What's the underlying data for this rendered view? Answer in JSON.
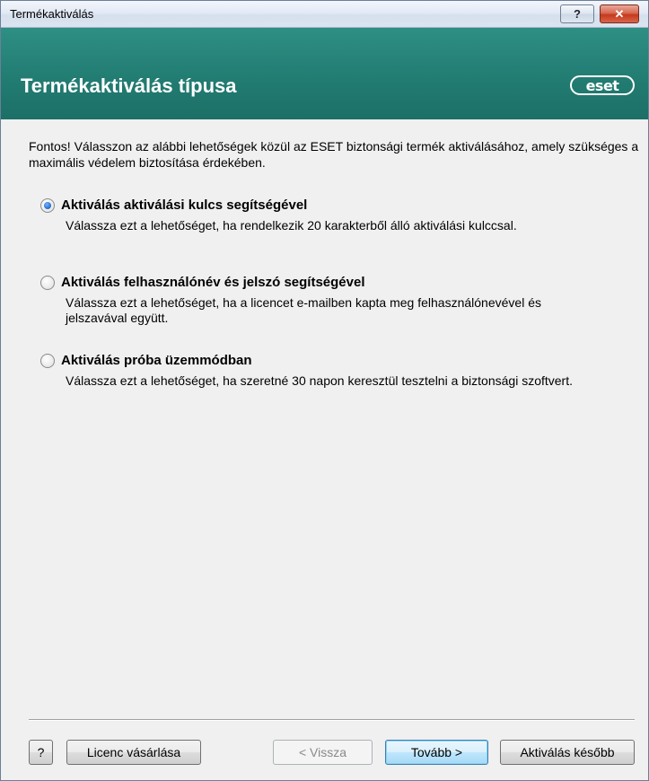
{
  "window": {
    "title": "Termékaktiválás",
    "help_glyph": "?",
    "close_glyph": "✕"
  },
  "header": {
    "heading": "Termékaktiválás típusa",
    "logo_text": "eset"
  },
  "intro": "Fontos! Válasszon az alábbi lehetőségek közül az ESET biztonsági termék aktiválásához, amely szükséges a maximális védelem biztosítása érdekében.",
  "options": [
    {
      "label": "Aktiválás aktiválási kulcs segítségével",
      "description": "Válassza ezt a lehetőséget, ha rendelkezik 20 karakterből álló aktiválási kulccsal.",
      "selected": true
    },
    {
      "label": "Aktiválás felhasználónév és jelszó segítségével",
      "description": "Válassza ezt a lehetőséget, ha a licencet e-mailben kapta meg felhasználónevével és jelszavával együtt.",
      "selected": false
    },
    {
      "label": "Aktiválás próba üzemmódban",
      "description": "Válassza ezt a lehetőséget, ha szeretné 30 napon keresztül tesztelni a biztonsági szoftvert.",
      "selected": false
    }
  ],
  "buttons": {
    "help": "?",
    "buy_license": "Licenc vásárlása",
    "back": "< Vissza",
    "next": "Tovább >",
    "activate_later": "Aktiválás később"
  },
  "colors": {
    "header_teal": "#237e74",
    "accent_blue": "#1a5fc0"
  }
}
